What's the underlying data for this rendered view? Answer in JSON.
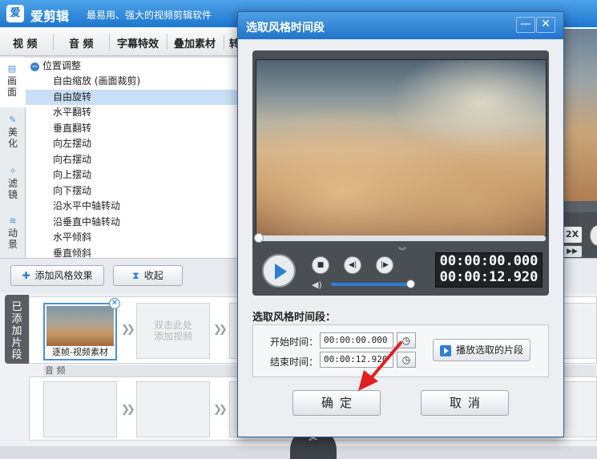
{
  "app": {
    "name": "爱剪辑",
    "slogan": "最易用、强大的视频剪辑软件",
    "logo_text": "爱"
  },
  "menu": {
    "items": [
      "视  频",
      "音  频",
      "字幕特效",
      "叠加素材",
      "转"
    ]
  },
  "sidetabs": [
    {
      "label": "画面",
      "icon": "screen-icon"
    },
    {
      "label": "美化",
      "icon": "wand-icon"
    },
    {
      "label": "滤镜",
      "icon": "sparkle-wand-icon"
    },
    {
      "label": "动景",
      "icon": "wave-icon"
    }
  ],
  "effects": {
    "group": "位置调整",
    "items": [
      "自由缩放 (画面裁剪)",
      "自由旋转",
      "水平翻转",
      "垂直翻转",
      "向左摆动",
      "向右摆动",
      "向上摆动",
      "向下摆动",
      "沿水平中轴转动",
      "沿垂直中轴转动",
      "水平倾斜",
      "垂直倾斜"
    ],
    "selected_index": 1
  },
  "bottombar": {
    "add_effect_label": "添加风格效果",
    "collapse_label": "收起"
  },
  "timeline": {
    "added_tab_label": "已添加片段",
    "clip_label": "逐帧-视频素材",
    "empty_clip_text": "双击此处\n添加视频",
    "audio_label": "音  频",
    "chevrons": "❯❯"
  },
  "dialog": {
    "title": "选取风格时间段",
    "min_symbol": "—",
    "close_symbol": "✕",
    "player": {
      "current_time": "00:00:00.000",
      "total_time": "00:00:12.920",
      "progress": 0.0,
      "volume": 0.95
    },
    "section_title": "选取风格时间段：",
    "start_label": "开始时间：",
    "start_value": "00:00:00.000",
    "end_label": "结束时间：",
    "end_value": "00:00:12.920",
    "play_selection_label": "播放选取的片段",
    "ok_label": "确定",
    "cancel_label": "取消"
  },
  "right_panel": {
    "speed_label": "2X"
  },
  "colors": {
    "accent": "#2c7fd2",
    "title_blue": "#2174c9",
    "annotation_red": "#e02020"
  }
}
